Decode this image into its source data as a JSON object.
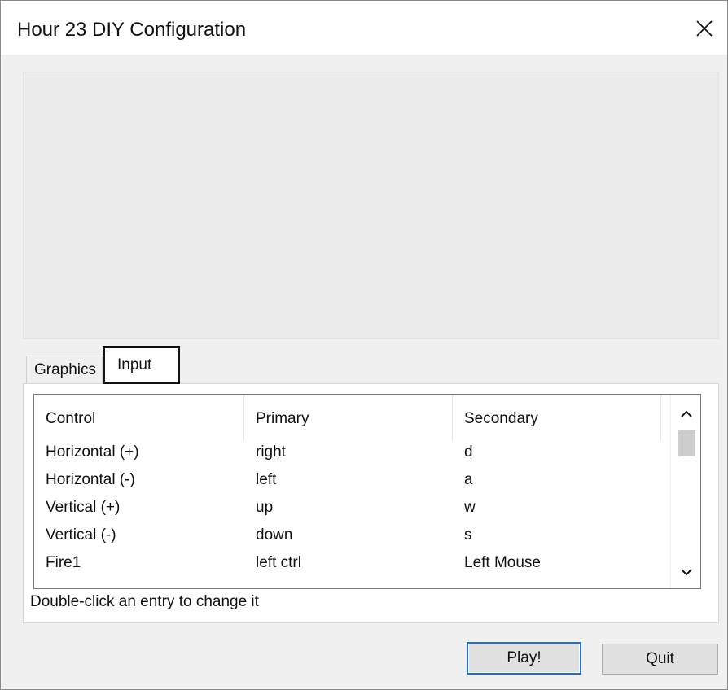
{
  "window": {
    "title": "Hour 23 DIY Configuration",
    "close_glyph": "✕"
  },
  "tabs": [
    {
      "label": "Graphics",
      "selected": false
    },
    {
      "label": "Input",
      "selected": true
    }
  ],
  "input_list": {
    "columns": [
      "Control",
      "Primary",
      "Secondary"
    ],
    "rows": [
      {
        "control": "Horizontal (+)",
        "primary": "right",
        "secondary": "d"
      },
      {
        "control": "Horizontal (-)",
        "primary": "left",
        "secondary": "a"
      },
      {
        "control": "Vertical (+)",
        "primary": "up",
        "secondary": "w"
      },
      {
        "control": "Vertical (-)",
        "primary": "down",
        "secondary": "s"
      },
      {
        "control": "Fire1",
        "primary": "left ctrl",
        "secondary": "Left Mouse"
      }
    ],
    "scroll_up_icon": "chevron-up-icon",
    "scroll_down_icon": "chevron-down-icon"
  },
  "hint": "Double-click an entry to change it",
  "buttons": {
    "play_label": "Play!",
    "quit_label": "Quit"
  },
  "colors": {
    "default_button_border": "#1f6fd0",
    "panel_background": "#f0f0f0",
    "selected_tab_border": "#111111"
  }
}
